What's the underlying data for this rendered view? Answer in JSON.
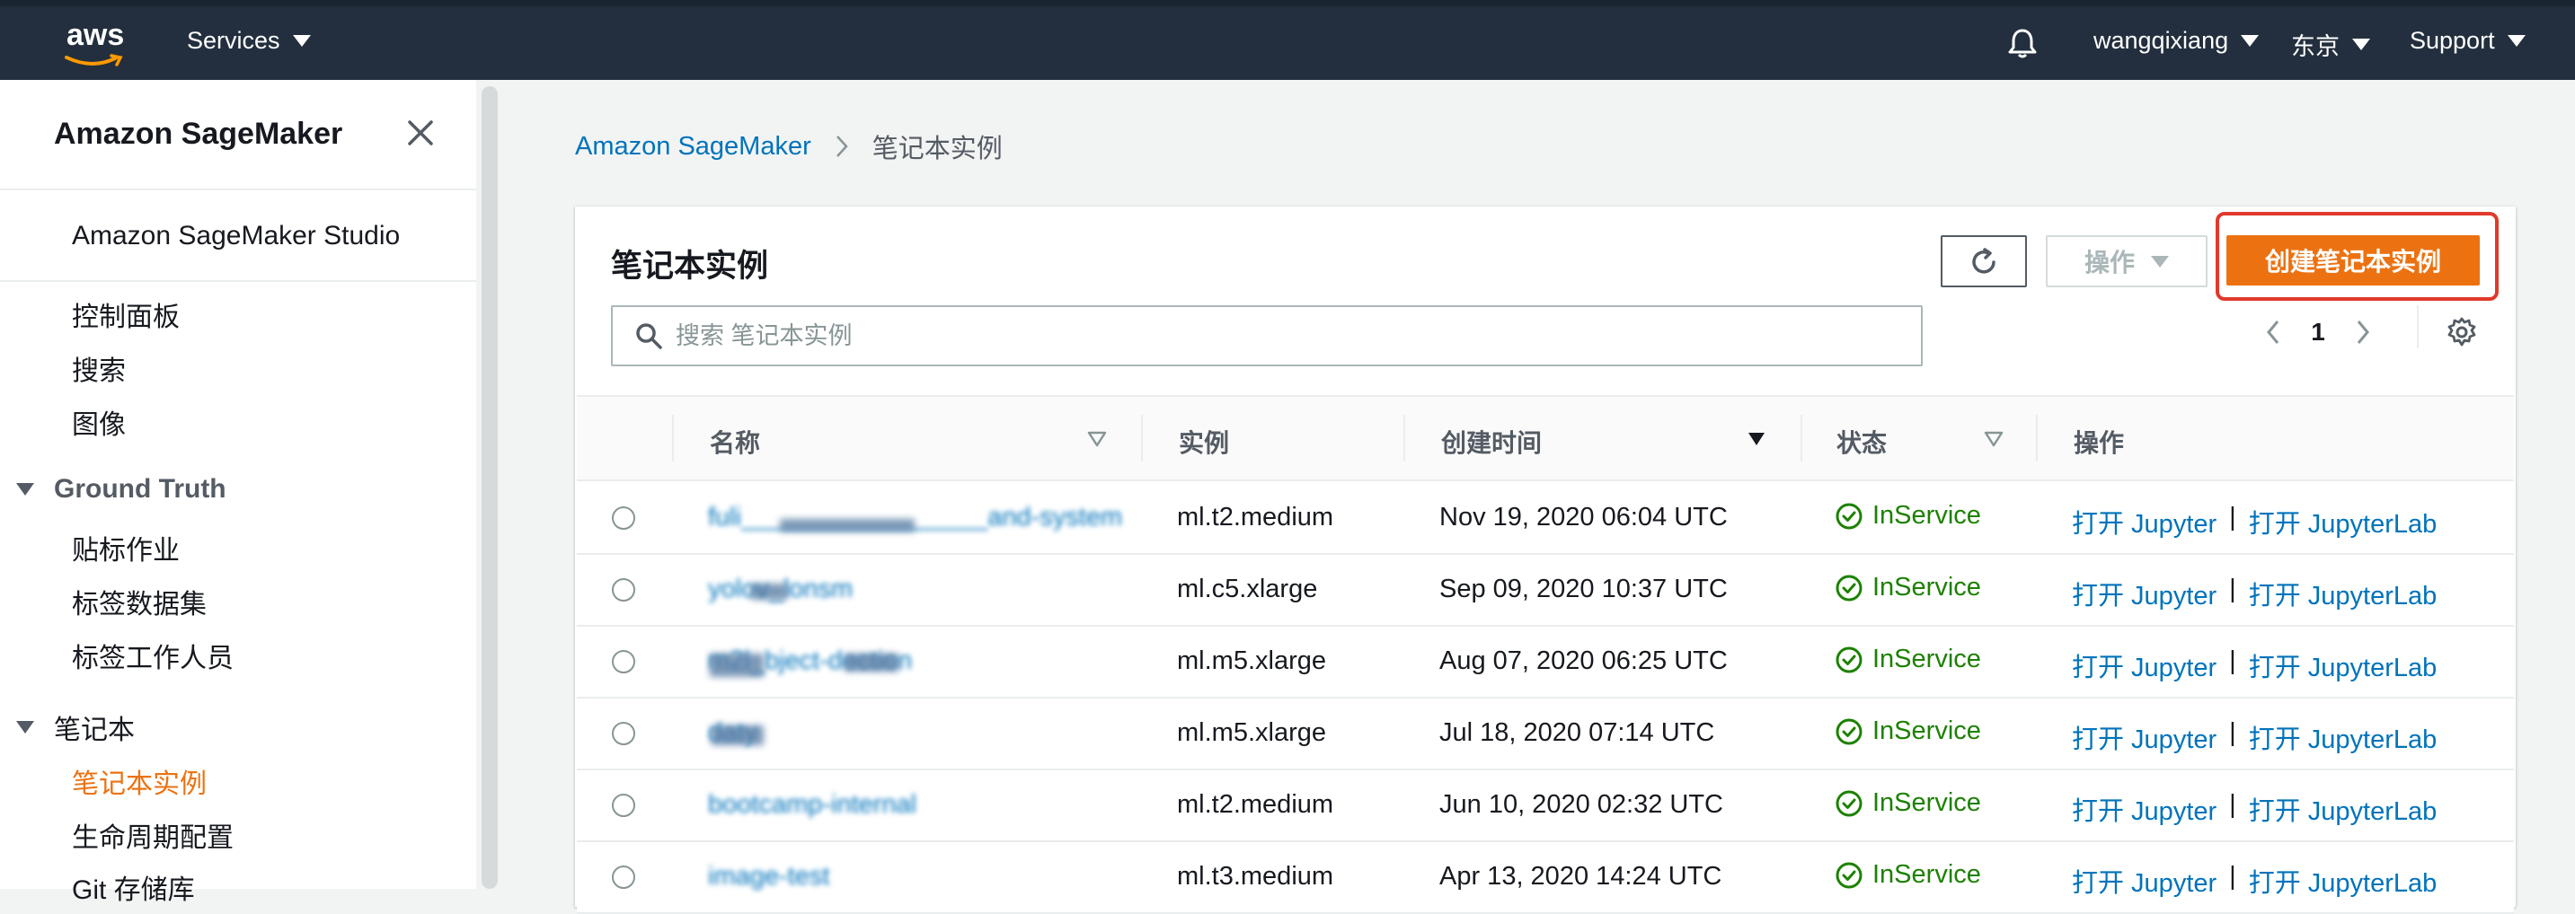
{
  "topnav": {
    "logo": "aws",
    "services_label": "Services",
    "user_label": "wangqixiang",
    "region_label": "东京",
    "support_label": "Support",
    "bell_icon": "bell-icon"
  },
  "sidebar": {
    "title": "Amazon SageMaker",
    "studio_item": "Amazon SageMaker Studio",
    "items": [
      {
        "label": "控制面板"
      },
      {
        "label": "搜索"
      },
      {
        "label": "图像"
      }
    ],
    "sections": [
      {
        "label": "Ground Truth",
        "items": [
          {
            "label": "贴标作业"
          },
          {
            "label": "标签数据集"
          },
          {
            "label": "标签工作人员"
          }
        ]
      },
      {
        "label": "笔记本",
        "items": [
          {
            "label": "笔记本实例"
          },
          {
            "label": "生命周期配置"
          },
          {
            "label": "Git 存储库"
          }
        ]
      }
    ]
  },
  "breadcrumb": {
    "root": "Amazon SageMaker",
    "current": "笔记本实例"
  },
  "panel": {
    "title": "笔记本实例",
    "actions_label": "操作",
    "create_label": "创建笔记本实例",
    "search_placeholder": "搜索 笔记本实例",
    "page_number": "1"
  },
  "table": {
    "columns": {
      "name": "名称",
      "instance": "实例",
      "created": "创建时间",
      "status": "状态",
      "actions": "操作"
    },
    "rows": [
      {
        "name": "fuli_________________and-system",
        "instance": "ml.t2.medium",
        "created": "Nov 19, 2020 06:04 UTC",
        "status": "InService",
        "open_jupyter": "打开 Jupyter",
        "sep": "|",
        "open_lab": "打开 JupyterLab"
      },
      {
        "name": "yolov_lonsm",
        "instance": "ml.c5.xlarge",
        "created": "Sep 09, 2020 10:37 UTC",
        "status": "InService",
        "open_jupyter": "打开 Jupyter",
        "sep": "|",
        "open_lab": "打开 JupyterLab"
      },
      {
        "name": "m2l_bject-dection",
        "instance": "ml.m5.xlarge",
        "created": "Aug 07, 2020 06:25 UTC",
        "status": "InService",
        "open_jupyter": "打开 Jupyter",
        "sep": "|",
        "open_lab": "打开 JupyterLab"
      },
      {
        "name": "daty",
        "instance": "ml.m5.xlarge",
        "created": "Jul 18, 2020 07:14 UTC",
        "status": "InService",
        "open_jupyter": "打开 Jupyter",
        "sep": "|",
        "open_lab": "打开 JupyterLab"
      },
      {
        "name": "bootcamp-internal",
        "instance": "ml.t2.medium",
        "created": "Jun 10, 2020 02:32 UTC",
        "status": "InService",
        "open_jupyter": "打开 Jupyter",
        "sep": "|",
        "open_lab": "打开 JupyterLab"
      },
      {
        "name": "image-test",
        "instance": "ml.t3.medium",
        "created": "Apr 13, 2020 14:24 UTC",
        "status": "InService",
        "open_jupyter": "打开 Jupyter",
        "sep": "|",
        "open_lab": "打开 JupyterLab"
      }
    ]
  },
  "colors": {
    "nav_bg": "#232f3e",
    "accent_orange": "#ec7211",
    "link_blue": "#0073bb",
    "success_green": "#1d8102",
    "highlight_red": "#e0392b"
  }
}
